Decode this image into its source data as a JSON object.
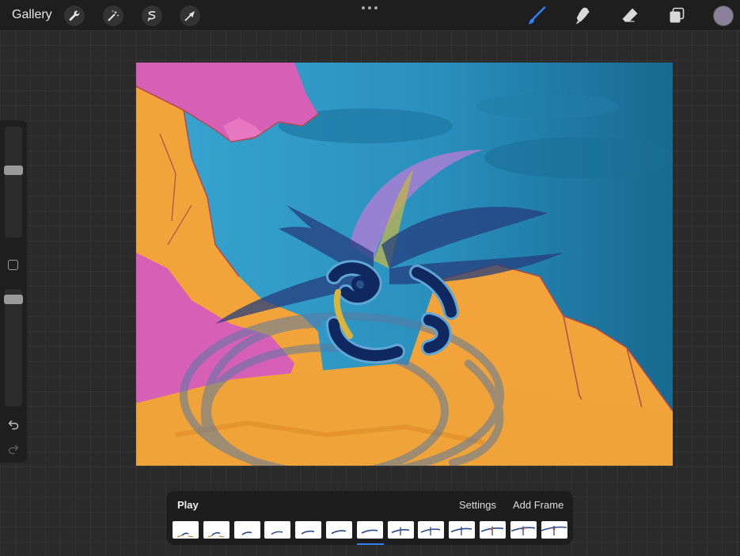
{
  "topbar": {
    "gallery_label": "Gallery",
    "left_tools": [
      "wrench-icon",
      "magic-wand-icon",
      "selection-icon",
      "transform-arrow-icon"
    ],
    "right_tools": [
      "brush-icon",
      "smudge-icon",
      "eraser-icon",
      "layers-icon"
    ],
    "active_tool": "brush-icon",
    "active_color": "#8a8099",
    "accent_color": "#2f7ff7"
  },
  "sidebar": {
    "brush_size_level": 0.62,
    "opacity_level": 0.95,
    "icons": [
      "modify-square-icon",
      "undo-icon",
      "redo-icon"
    ]
  },
  "animation": {
    "play_label": "Play",
    "settings_label": "Settings",
    "add_frame_label": "Add Frame",
    "frame_count": 13,
    "selected_frame_index": 6
  }
}
